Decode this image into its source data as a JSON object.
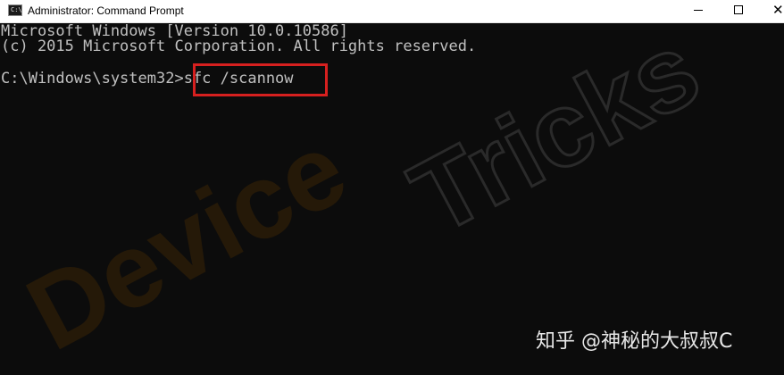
{
  "window": {
    "title": "Administrator: Command Prompt",
    "app_icon": "cmd-icon",
    "app_icon_glyph": "C:\\",
    "controls": {
      "minimize_icon": "minimize-icon",
      "maximize_icon": "maximize-icon",
      "close_icon": "close-icon",
      "close_glyph": "✕"
    }
  },
  "console": {
    "line1": "Microsoft Windows [Version 10.0.10586]",
    "line2": "(c) 2015 Microsoft Corporation. All rights reserved.",
    "prompt": "C:\\Windows\\system32>",
    "command": "sfc /scannow",
    "highlight_color": "#d6201f",
    "text_color": "#c0c0c0",
    "background_color": "#0c0c0c"
  },
  "watermarks": {
    "brand": "DeviceTricks",
    "brand_part1": "Device",
    "brand_part2": "Tricks",
    "zhihu": "知乎 @神秘的大叔叔C"
  }
}
